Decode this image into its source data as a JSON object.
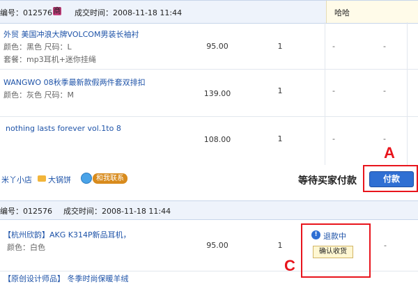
{
  "order1": {
    "order_no_label": "编号：012576",
    "shop_badge": "商",
    "deal_time": "成交时间：2008-11-18 11:44",
    "buyer_name": "哈哈",
    "items": [
      {
        "title": "外贸 美国冲浪大牌VOLCOM男装长袖衬",
        "attr1": "颜色：黑色  尺码：L",
        "attr2": "套餐：mp3耳机+迷你挂绳",
        "price": "95.00",
        "qty": "1",
        "col_a": "-",
        "col_b": "-"
      },
      {
        "title": "WANGWO 08秋季最新款假两件套双排扣",
        "attr1": "颜色：灰色  尺码：M",
        "price": "139.00",
        "qty": "1",
        "col_a": "-",
        "col_b": "-"
      },
      {
        "title": "nothing lasts forever vol.1to 8",
        "price": "108.00",
        "qty": "1",
        "col_a": "-",
        "col_b": "-"
      }
    ],
    "footer": {
      "shop1": "米丫小店",
      "shop2": "大锅饼",
      "contact": "和我联系",
      "status": "等待买家付款",
      "pay_button": "付款"
    }
  },
  "order2": {
    "order_no_label": "编号：012576",
    "deal_time": "成交时间：2008-11-18 11:44",
    "items": [
      {
        "title": "【杭州欣韵】AKG K314P新品耳机，",
        "attr1": "颜色：白色",
        "price": "95.00",
        "qty": "1",
        "refund_status": "退款中",
        "confirm_button": "确认收货",
        "col_b": "-"
      }
    ],
    "next_title_partial": "【原创设计师品】 冬季时尚保暖羊绒"
  },
  "annotations": {
    "a": "A",
    "c": "C"
  },
  "colors": {
    "accent_red": "#e8141c",
    "pay_blue": "#2f6fd3",
    "link_blue": "#1e53a8"
  }
}
